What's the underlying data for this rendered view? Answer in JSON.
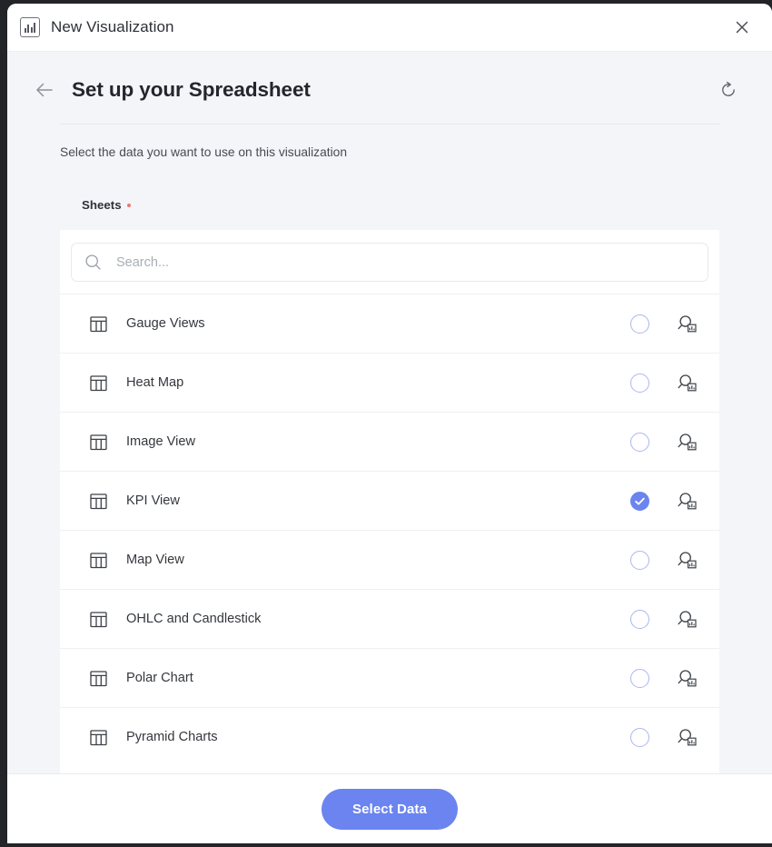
{
  "window": {
    "title": "New Visualization",
    "app_icon": "bar-chart-icon",
    "close_icon": "close-icon"
  },
  "header": {
    "back_icon": "arrow-left-icon",
    "title": "Set up your Spreadsheet",
    "refresh_icon": "refresh-icon"
  },
  "subtitle": "Select the data you want to use on this visualization",
  "form": {
    "sheets_label": "Sheets",
    "required_marker": "•"
  },
  "search": {
    "icon": "search-icon",
    "value": "",
    "placeholder": "Search..."
  },
  "list": {
    "row_icon": "table-grid-icon",
    "preview_icon": "magnifier-chart-icon",
    "items": [
      {
        "label": "Gauge Views",
        "selected": false
      },
      {
        "label": "Heat Map",
        "selected": false
      },
      {
        "label": "Image View",
        "selected": false
      },
      {
        "label": "KPI View",
        "selected": true
      },
      {
        "label": "Map View",
        "selected": false
      },
      {
        "label": "OHLC and Candlestick",
        "selected": false
      },
      {
        "label": "Polar Chart",
        "selected": false
      },
      {
        "label": "Pyramid Charts",
        "selected": false
      }
    ]
  },
  "footer": {
    "primary_label": "Select Data"
  },
  "colors": {
    "accent": "#6b84ef",
    "radio_outline": "#aab6ef",
    "page_bg": "#f4f5f9",
    "panel_bg": "#ffffff",
    "required_dot": "#e8796f",
    "text_primary": "#23262c",
    "text_secondary": "#474b52"
  }
}
